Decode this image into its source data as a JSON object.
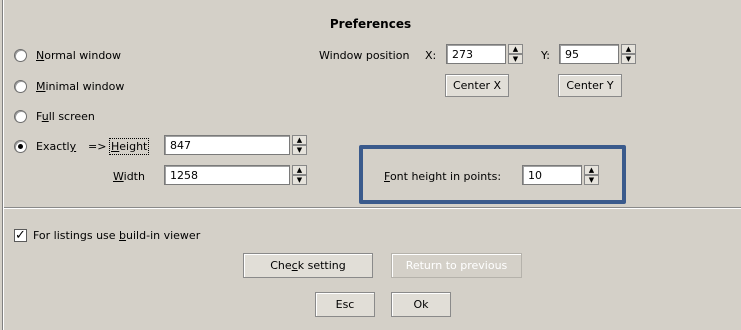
{
  "title": "Preferences",
  "window_modes": [
    {
      "pre": "",
      "key": "N",
      "post": "ormal window",
      "selected": false
    },
    {
      "pre": "",
      "key": "M",
      "post": "inimal window",
      "selected": false
    },
    {
      "pre": "F",
      "key": "u",
      "post": "ll screen",
      "selected": false
    },
    {
      "pre": "Exactl",
      "key": "y",
      "post": "",
      "selected": true
    }
  ],
  "exactly": {
    "arrow": "=>",
    "height_label_key": "H",
    "height_label_rest": "eight",
    "height_value": "847",
    "width_label_key": "W",
    "width_label_rest": "idth",
    "width_value": "1258"
  },
  "position": {
    "label": "Window position",
    "x_label": "X:",
    "x_value": "273",
    "y_label": "Y:",
    "y_value": "95",
    "center_x": "Center X",
    "center_y": "Center Y"
  },
  "font": {
    "label_key": "F",
    "label_rest": "ont height in points:",
    "value": "10"
  },
  "viewer": {
    "checked": true,
    "pre": "For listings use ",
    "key": "b",
    "post": "uild-in viewer"
  },
  "buttons": {
    "check_pre": "Che",
    "check_key": "c",
    "check_post": "k setting",
    "return": "Return to previous",
    "esc": "Esc",
    "ok": "Ok"
  },
  "colors": {
    "highlight": "#3a5a8c"
  }
}
